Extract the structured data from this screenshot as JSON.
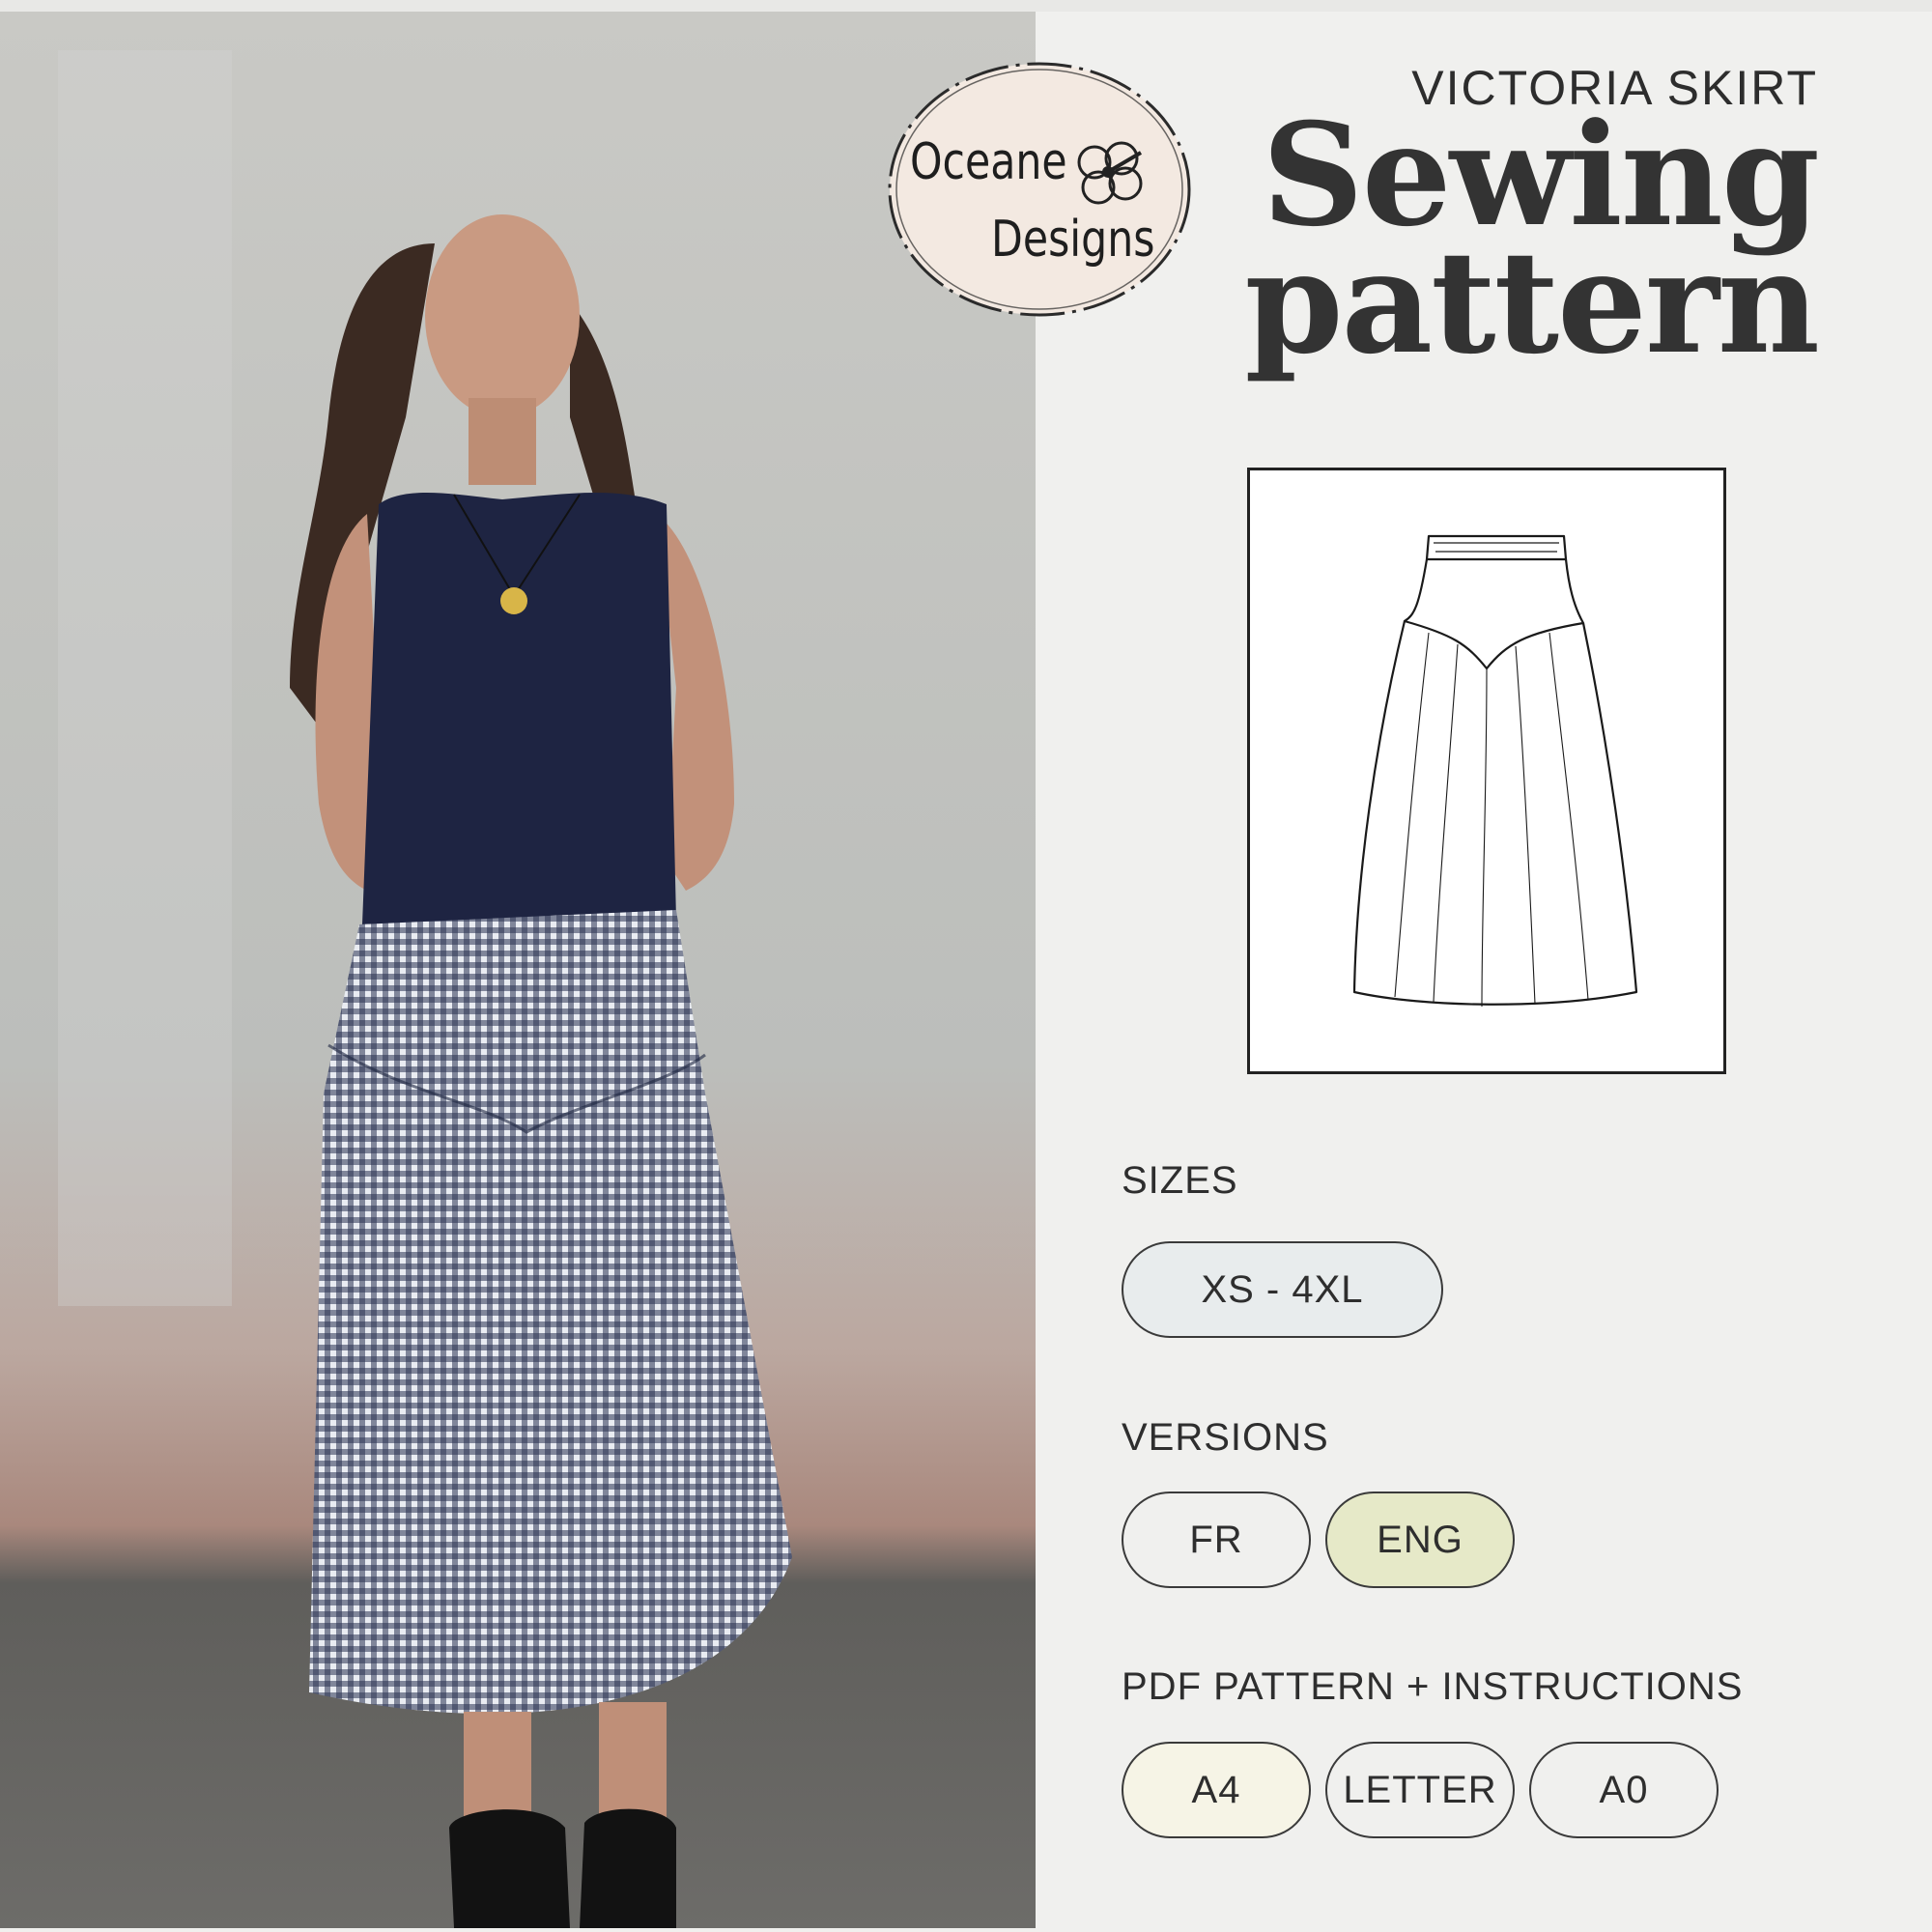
{
  "brand": {
    "line1": "Oceane",
    "line2": "Designs",
    "logo_icon": "hibiscus-flower-icon"
  },
  "product": {
    "name": "VICTORIA SKIRT",
    "title_line1": "Sewing",
    "title_line2": "pattern"
  },
  "sizes": {
    "label": "SIZES",
    "value": "XS - 4XL"
  },
  "versions": {
    "label": "VERSIONS",
    "options": [
      "FR",
      "ENG"
    ]
  },
  "formats": {
    "label": "PDF PATTERN + INSTRUCTIONS",
    "options": [
      "A4",
      "LETTER",
      "A0"
    ]
  },
  "colors": {
    "background": "#f0f0ee",
    "title": "#333333",
    "sizes_pill": "#e8eced",
    "eng_pill": "#e6e9c8",
    "a4_pill": "#f6f4e6",
    "outline": "#3a3a3a"
  }
}
